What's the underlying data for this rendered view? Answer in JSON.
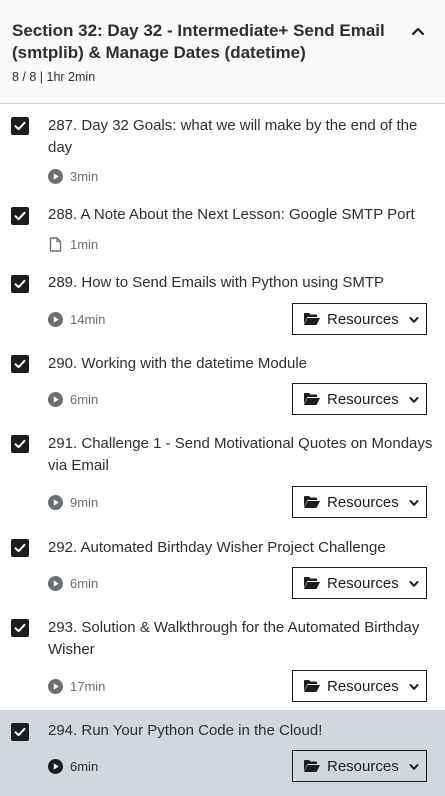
{
  "section": {
    "title": "Section 32: Day 32 - Intermediate+ Send Email (smtplib) & Manage Dates (datetime)",
    "meta": "8 / 8 | 1hr 2min"
  },
  "lectures": [
    {
      "title": "287. Day 32 Goals: what we will make by the end of the day",
      "duration": "3min",
      "icon": "play-circle-icon",
      "has_resources": false,
      "checked": true
    },
    {
      "title": "288. A Note About the Next Lesson: Google SMTP Port",
      "duration": "1min",
      "icon": "file-icon",
      "has_resources": false,
      "checked": true
    },
    {
      "title": "289. How to Send Emails with Python using SMTP",
      "duration": "14min",
      "icon": "play-circle-icon",
      "has_resources": true,
      "resources_label": "Resources",
      "checked": true
    },
    {
      "title": "290. Working with the datetime Module",
      "duration": "6min",
      "icon": "play-circle-icon",
      "has_resources": true,
      "resources_label": "Resources",
      "checked": true
    },
    {
      "title": "291. Challenge 1 - Send Motivational Quotes on Mondays via Email",
      "duration": "9min",
      "icon": "play-circle-icon",
      "has_resources": true,
      "resources_label": "Resources",
      "checked": true
    },
    {
      "title": "292. Automated Birthday Wisher Project Challenge",
      "duration": "6min",
      "icon": "play-circle-icon",
      "has_resources": true,
      "resources_label": "Resources",
      "checked": true
    },
    {
      "title": "293. Solution & Walkthrough for the Automated Birthday Wisher",
      "duration": "17min",
      "icon": "play-circle-icon",
      "has_resources": true,
      "resources_label": "Resources",
      "checked": true
    },
    {
      "title": "294. Run Your Python Code in the Cloud!",
      "duration": "6min",
      "icon": "play-circle-icon",
      "has_resources": true,
      "resources_label": "Resources",
      "checked": true,
      "active": true
    }
  ],
  "colors": {
    "header_bg": "#f7f9fa",
    "active_bg": "#d1d7dc",
    "checkbox": "#1c1d1f",
    "muted_text": "#6a6f73"
  }
}
